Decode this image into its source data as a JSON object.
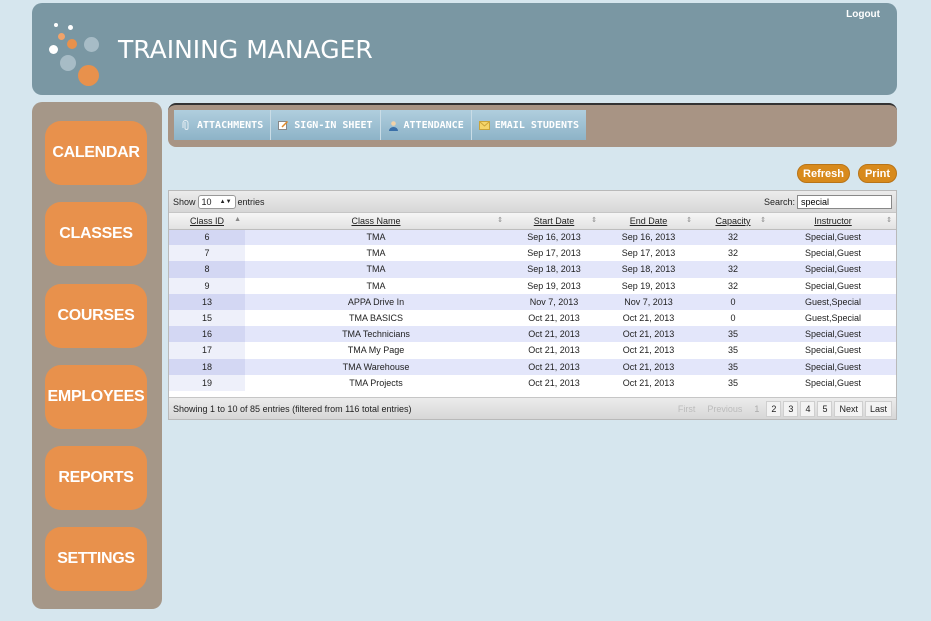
{
  "header": {
    "title": "TRAINING MANAGER",
    "logout_label": "Logout"
  },
  "sidebar": {
    "items": [
      {
        "label": "CALENDAR"
      },
      {
        "label": "CLASSES"
      },
      {
        "label": "COURSES"
      },
      {
        "label": "EMPLOYEES"
      },
      {
        "label": "REPORTS"
      },
      {
        "label": "SETTINGS"
      }
    ]
  },
  "toolbar": {
    "attachments": "ATTACHMENTS",
    "signin": "SIGN-IN SHEET",
    "attendance": "ATTENDANCE",
    "email": "EMAIL STUDENTS"
  },
  "actions": {
    "refresh": "Refresh",
    "print": "Print"
  },
  "table": {
    "show_label": "Show",
    "entries_label": "entries",
    "page_length": "10",
    "search_label": "Search:",
    "search_value": "special",
    "columns": [
      "Class ID",
      "Class Name",
      "Start Date",
      "End Date",
      "Capacity",
      "Instructor"
    ],
    "rows": [
      [
        "6",
        "TMA",
        "Sep 16, 2013",
        "Sep 16, 2013",
        "32",
        "Special,Guest"
      ],
      [
        "7",
        "TMA",
        "Sep 17, 2013",
        "Sep 17, 2013",
        "32",
        "Special,Guest"
      ],
      [
        "8",
        "TMA",
        "Sep 18, 2013",
        "Sep 18, 2013",
        "32",
        "Special,Guest"
      ],
      [
        "9",
        "TMA",
        "Sep 19, 2013",
        "Sep 19, 2013",
        "32",
        "Special,Guest"
      ],
      [
        "13",
        "APPA Drive In",
        "Nov 7, 2013",
        "Nov 7, 2013",
        "0",
        "Guest,Special"
      ],
      [
        "15",
        "TMA BASICS",
        "Oct 21, 2013",
        "Oct 21, 2013",
        "0",
        "Guest,Special"
      ],
      [
        "16",
        "TMA Technicians",
        "Oct 21, 2013",
        "Oct 21, 2013",
        "35",
        "Special,Guest"
      ],
      [
        "17",
        "TMA My Page",
        "Oct 21, 2013",
        "Oct 21, 2013",
        "35",
        "Special,Guest"
      ],
      [
        "18",
        "TMA Warehouse",
        "Oct 21, 2013",
        "Oct 21, 2013",
        "35",
        "Special,Guest"
      ],
      [
        "19",
        "TMA Projects",
        "Oct 21, 2013",
        "Oct 21, 2013",
        "35",
        "Special,Guest"
      ]
    ],
    "info": "Showing 1 to 10 of 85 entries (filtered from 116 total entries)",
    "pager": {
      "first": "First",
      "previous": "Previous",
      "pages": [
        "1",
        "2",
        "3",
        "4",
        "5"
      ],
      "next": "Next",
      "last": "Last"
    }
  },
  "colors": {
    "accent": "#e8914c",
    "header_bg": "#7a97a3",
    "sidebar_bg": "#a59788",
    "button_orange": "#d88a1c"
  }
}
